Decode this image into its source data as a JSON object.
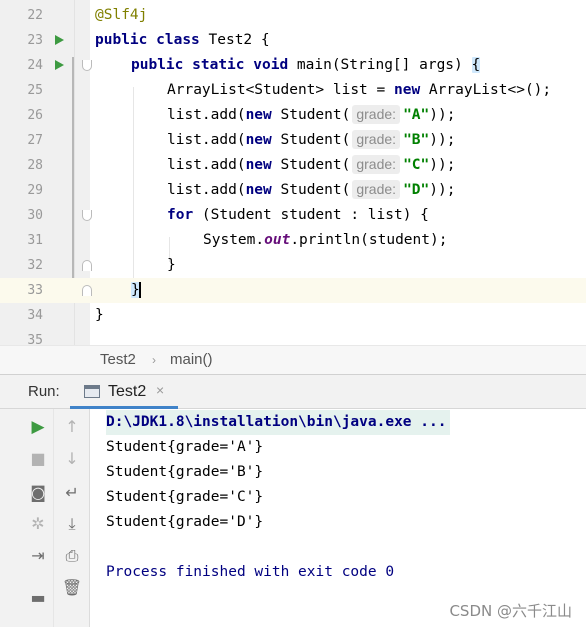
{
  "editor": {
    "line_numbers": [
      "22",
      "23",
      "24",
      "25",
      "26",
      "27",
      "28",
      "29",
      "30",
      "31",
      "32",
      "33",
      "34",
      "35"
    ],
    "annotation": "@Slf4j",
    "kw_public": "public",
    "kw_class": "class",
    "class_name": " Test2 {",
    "kw_static": "static",
    "kw_void": "void",
    "main_sig": " main(String[] args) ",
    "open_brace": "{",
    "line25_a": "ArrayList<Student> list = ",
    "kw_new": "new",
    "line25_b": " ArrayList<>();",
    "list_add": "list.add(",
    "student_ctor": " Student(",
    "param_hint": "grade:",
    "grades": [
      "\"A\"",
      "\"B\"",
      "\"C\"",
      "\"D\""
    ],
    "call_close": "));",
    "kw_for": "for",
    "for_body": " (Student student : list) {",
    "sysout_a": "System.",
    "sysout_field": "out",
    "sysout_b": ".println(student);",
    "close_brace": "}"
  },
  "breadcrumb": {
    "class": "Test2",
    "separator": "›",
    "method": "main()"
  },
  "run_panel": {
    "title": "Run:",
    "tab_label": "Test2",
    "tab_close": "×",
    "console_lines": [
      "D:\\JDK1.8\\installation\\bin\\java.exe ...",
      "Student{grade='A'}",
      "Student{grade='B'}",
      "Student{grade='C'}",
      "Student{grade='D'}",
      "",
      "Process finished with exit code 0"
    ],
    "toolbar_icons": [
      "run-icon",
      "stop-icon",
      "camera-icon",
      "settings-icon",
      "login-icon",
      "layout-icon",
      "up-arrow-icon",
      "down-arrow-icon",
      "soft-wrap-icon",
      "scroll-to-end-icon",
      "print-icon",
      "trash-icon"
    ]
  },
  "watermark": "CSDN @六千江山",
  "colors": {
    "keyword": "#000080",
    "string": "#008000",
    "annotation": "#808000",
    "field": "#660e7a",
    "run_green": "#3d9a41",
    "tab_underline": "#4083c9"
  }
}
